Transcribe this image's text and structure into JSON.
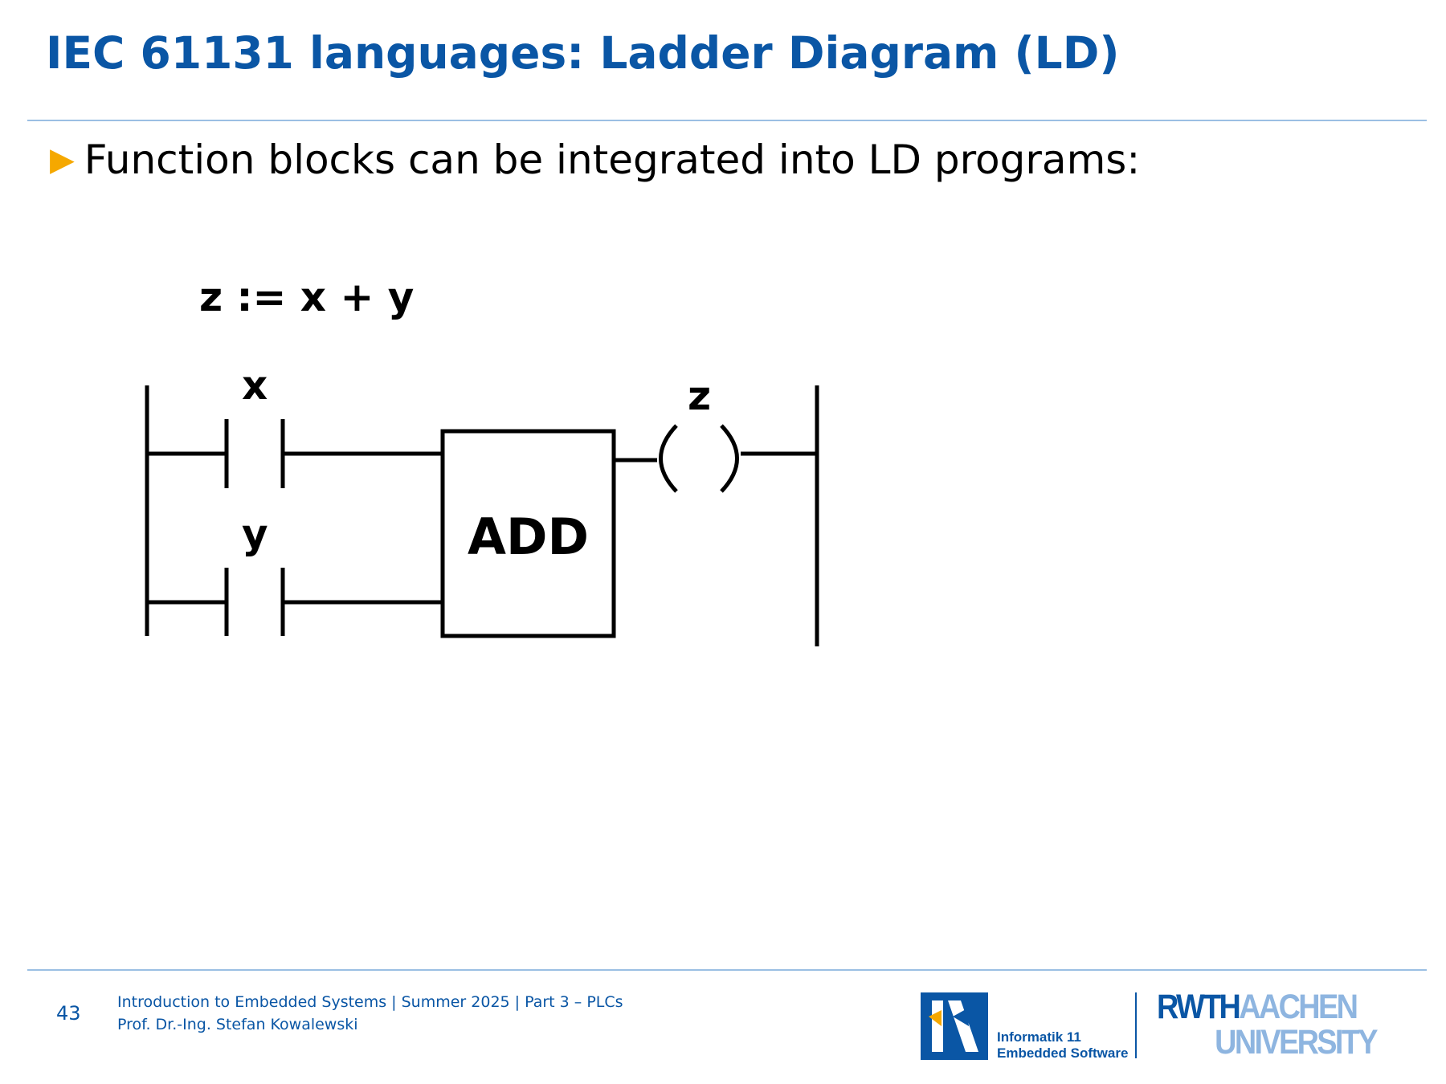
{
  "slide": {
    "title": "IEC 61131 languages: Ladder Diagram (LD)",
    "bullet": "Function blocks can be integrated into LD programs:"
  },
  "diagram": {
    "equation": "z := x + y",
    "contact_x_label": "x",
    "contact_y_label": "y",
    "block_label": "ADD",
    "coil_label": "z"
  },
  "footer": {
    "page_number": "43",
    "course_line": "Introduction to Embedded Systems | Summer 2025 | Part 3 – PLCs",
    "author_line": "Prof. Dr.-Ing. Stefan Kowalewski",
    "institute_line1": "Informatik 11",
    "institute_line2": "Embedded Software",
    "university_word1_a": "RWTH",
    "university_word1_b": "AACHEN",
    "university_word2": "UNIVERSITY"
  },
  "colors": {
    "title": "#0a56a5",
    "bullet_arrow": "#f5a800",
    "rule": "#9bbfe3",
    "logo_light": "#8eb5e0"
  },
  "icons": {
    "bullet": "triangle-right-icon",
    "institute_logo": "informatik-11-logo-icon"
  }
}
